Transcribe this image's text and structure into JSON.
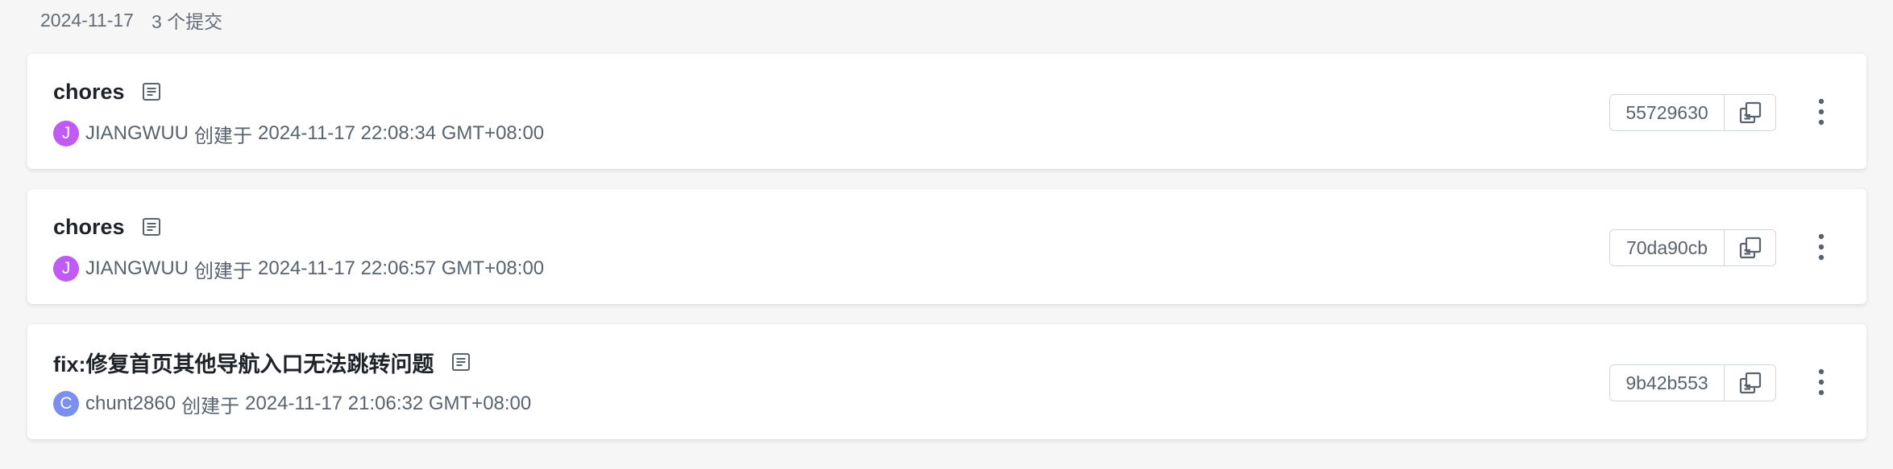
{
  "group": {
    "date": "2024-11-17",
    "count_label": "3 个提交"
  },
  "colors": {
    "avatar_j": "#bf5af2",
    "avatar_c": "#7b8ff0",
    "icon": "#59636e"
  },
  "icons": {
    "details": "text-lines-icon",
    "copy": "copy-icon",
    "more": "kebab-vertical-icon"
  },
  "commits": [
    {
      "title": "chores",
      "avatar_letter": "J",
      "author": "JIANGWUU",
      "created_label": "创建于",
      "timestamp": "2024-11-17 22:08:34 GMT+08:00",
      "sha": "55729630"
    },
    {
      "title": "chores",
      "avatar_letter": "J",
      "author": "JIANGWUU",
      "created_label": "创建于",
      "timestamp": "2024-11-17 22:06:57 GMT+08:00",
      "sha": "70da90cb"
    },
    {
      "title": "fix:修复首页其他导航入口无法跳转问题",
      "avatar_letter": "C",
      "author": "chunt2860",
      "created_label": "创建于",
      "timestamp": "2024-11-17 21:06:32 GMT+08:00",
      "sha": "9b42b553"
    }
  ]
}
